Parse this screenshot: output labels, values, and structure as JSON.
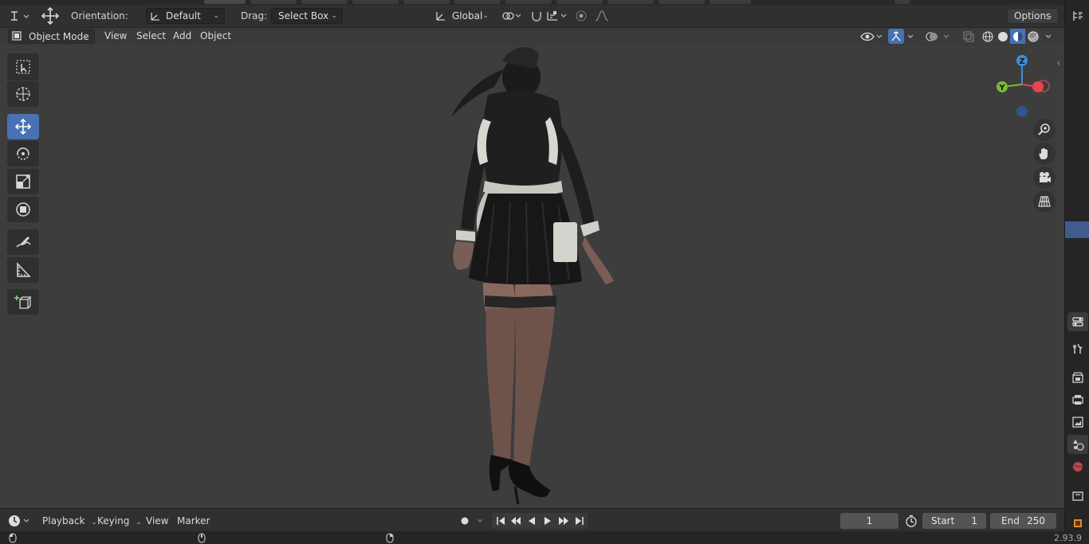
{
  "tool_settings": {
    "orientation_label": "Orientation:",
    "orientation_value": "Default",
    "drag_label": "Drag:",
    "drag_value": "Select Box",
    "transform_orientation": "Global",
    "options_label": "Options"
  },
  "viewport_header": {
    "mode": "Object Mode",
    "menus": [
      "View",
      "Select",
      "Add",
      "Object"
    ]
  },
  "gizmo": {
    "z_label": "Z",
    "y_label": "Y"
  },
  "timeline": {
    "menus": [
      "Playback",
      "Keying",
      "View",
      "Marker"
    ],
    "current_frame": "1",
    "start_label": "Start",
    "start_value": "1",
    "end_label": "End",
    "end_value": "250"
  },
  "status": {
    "version": "2.93.9"
  },
  "colors": {
    "accent": "#4772b3",
    "axis_x": "#e8434f",
    "axis_y": "#7db832",
    "axis_z": "#3b8ee0"
  }
}
